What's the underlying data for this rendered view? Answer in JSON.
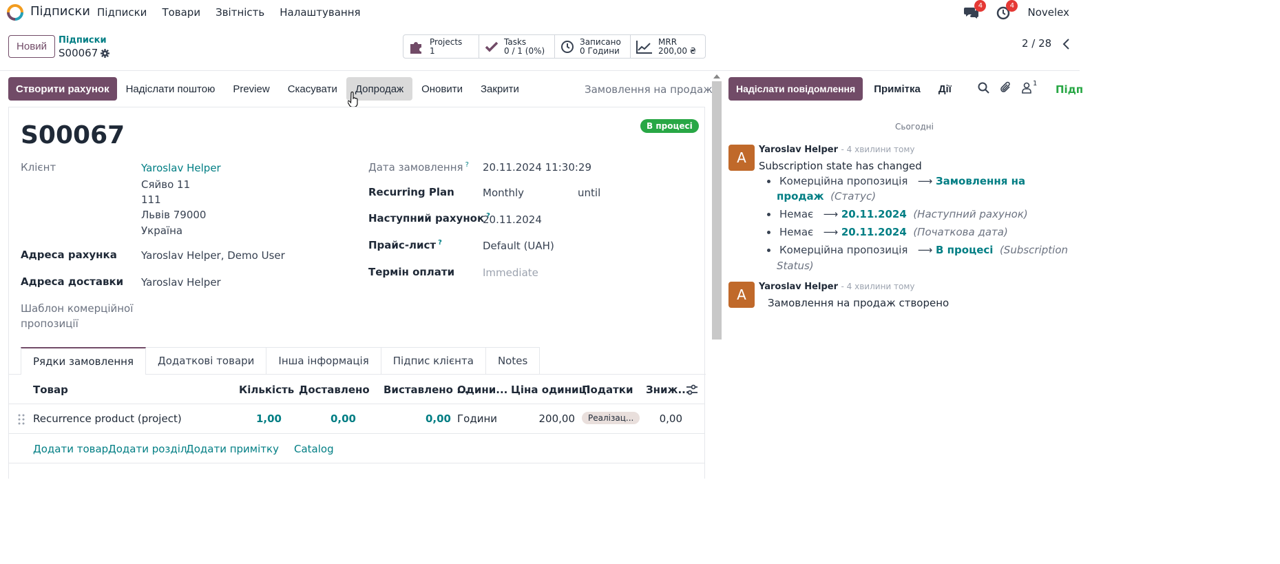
{
  "nav": {
    "app_name": "Підписки",
    "menu": [
      "Підписки",
      "Товари",
      "Звітність",
      "Налаштування"
    ],
    "messages_count": "4",
    "activities_count": "4",
    "company": "Novelex"
  },
  "control": {
    "new_label": "Новий",
    "breadcrumb_parent": "Підписки",
    "breadcrumb_current": "S00067",
    "stats": [
      {
        "label": "Projects",
        "value": "1"
      },
      {
        "label": "Tasks",
        "value": "0 / 1 (0%)"
      },
      {
        "label": "Записано",
        "value": "0 Години"
      },
      {
        "label": "MRR",
        "value": "200,00 ₴"
      }
    ],
    "pager": "2 / 28"
  },
  "actions": {
    "create_invoice": "Створити рахунок",
    "send_email": "Надіслати поштою",
    "preview": "Preview",
    "cancel": "Скасувати",
    "upsell": "Допродаж",
    "renew": "Оновити",
    "close": "Закрити",
    "status": "Замовлення на продаж"
  },
  "form": {
    "name": "S00067",
    "state": "В процесі",
    "customer_label": "Клієнт",
    "customer_name": "Yaroslav Helper",
    "address": [
      "Сяйво 11",
      "111",
      "Львів 79000",
      "Україна"
    ],
    "invoice_address_label": "Адреса рахунка",
    "invoice_address": "Yaroslav Helper, Demo User",
    "delivery_address_label": "Адреса доставки",
    "delivery_address": "Yaroslav Helper",
    "quote_template_label_1": "Шаблон комерційної",
    "quote_template_label_2": "пропозиції",
    "order_date_label": "Дата замовлення",
    "order_date": "20.11.2024 11:30:29",
    "plan_label": "Recurring Plan",
    "plan": "Monthly",
    "until": "until",
    "next_invoice_label": "Наступний рахунок",
    "next_invoice": "20.11.2024",
    "pricelist_label": "Прайс-лист",
    "pricelist": "Default (UAH)",
    "payment_terms_label": "Термін оплати",
    "payment_terms": "Immediate",
    "help_mark": "?"
  },
  "tabs": [
    "Рядки замовлення",
    "Додаткові товари",
    "Інша інформація",
    "Підпис клієнта",
    "Notes"
  ],
  "table": {
    "headers": [
      "Товар",
      "Кількість",
      "Доставлено",
      "Виставлено ...",
      "Одини...",
      "Ціна одиниці",
      "Податки",
      "Зниж..."
    ],
    "row": {
      "product": "Recurrence product (project)",
      "qty": "1,00",
      "delivered": "0,00",
      "invoiced": "0,00",
      "uom": "Години",
      "price": "200,00",
      "tax": "Реалізац...",
      "discount": "0,00"
    },
    "add_product": "Додати товар",
    "add_section": "Додати розділ",
    "add_note": "Додати примітку",
    "catalog": "Catalog"
  },
  "chatter": {
    "send_message": "Надіслати повідомлення",
    "log_note": "Примітка",
    "activities": "Дії",
    "followers_count": "1",
    "follow": "Підп",
    "today": "Сьогодні",
    "messages": [
      {
        "avatar": "A",
        "author": "Yaroslav Helper",
        "ago": "- 4 хвилини тому",
        "body": "Subscription state has changed",
        "tracking": [
          {
            "old": "Комерційна пропозиція",
            "new_1": "Замовлення на",
            "new_2": "продаж",
            "field": "(Статус)"
          },
          {
            "old": "Немає",
            "new": "20.11.2024",
            "field": "(Наступний рахунок)"
          },
          {
            "old": "Немає",
            "new": "20.11.2024",
            "field": "(Початкова дата)"
          },
          {
            "old": "Комерційна пропозиція",
            "new": "В процесі",
            "field_1": "(Subscription",
            "field_2": "Status)"
          }
        ]
      },
      {
        "avatar": "A",
        "author": "Yaroslav Helper",
        "ago": "- 4 хвилини тому",
        "body": "Замовлення на продаж створено"
      }
    ]
  },
  "colors": {
    "brand": "#714b67",
    "link": "#017e84",
    "success": "#28a745",
    "badge": "#e53935",
    "avatar": "#c0692a"
  }
}
